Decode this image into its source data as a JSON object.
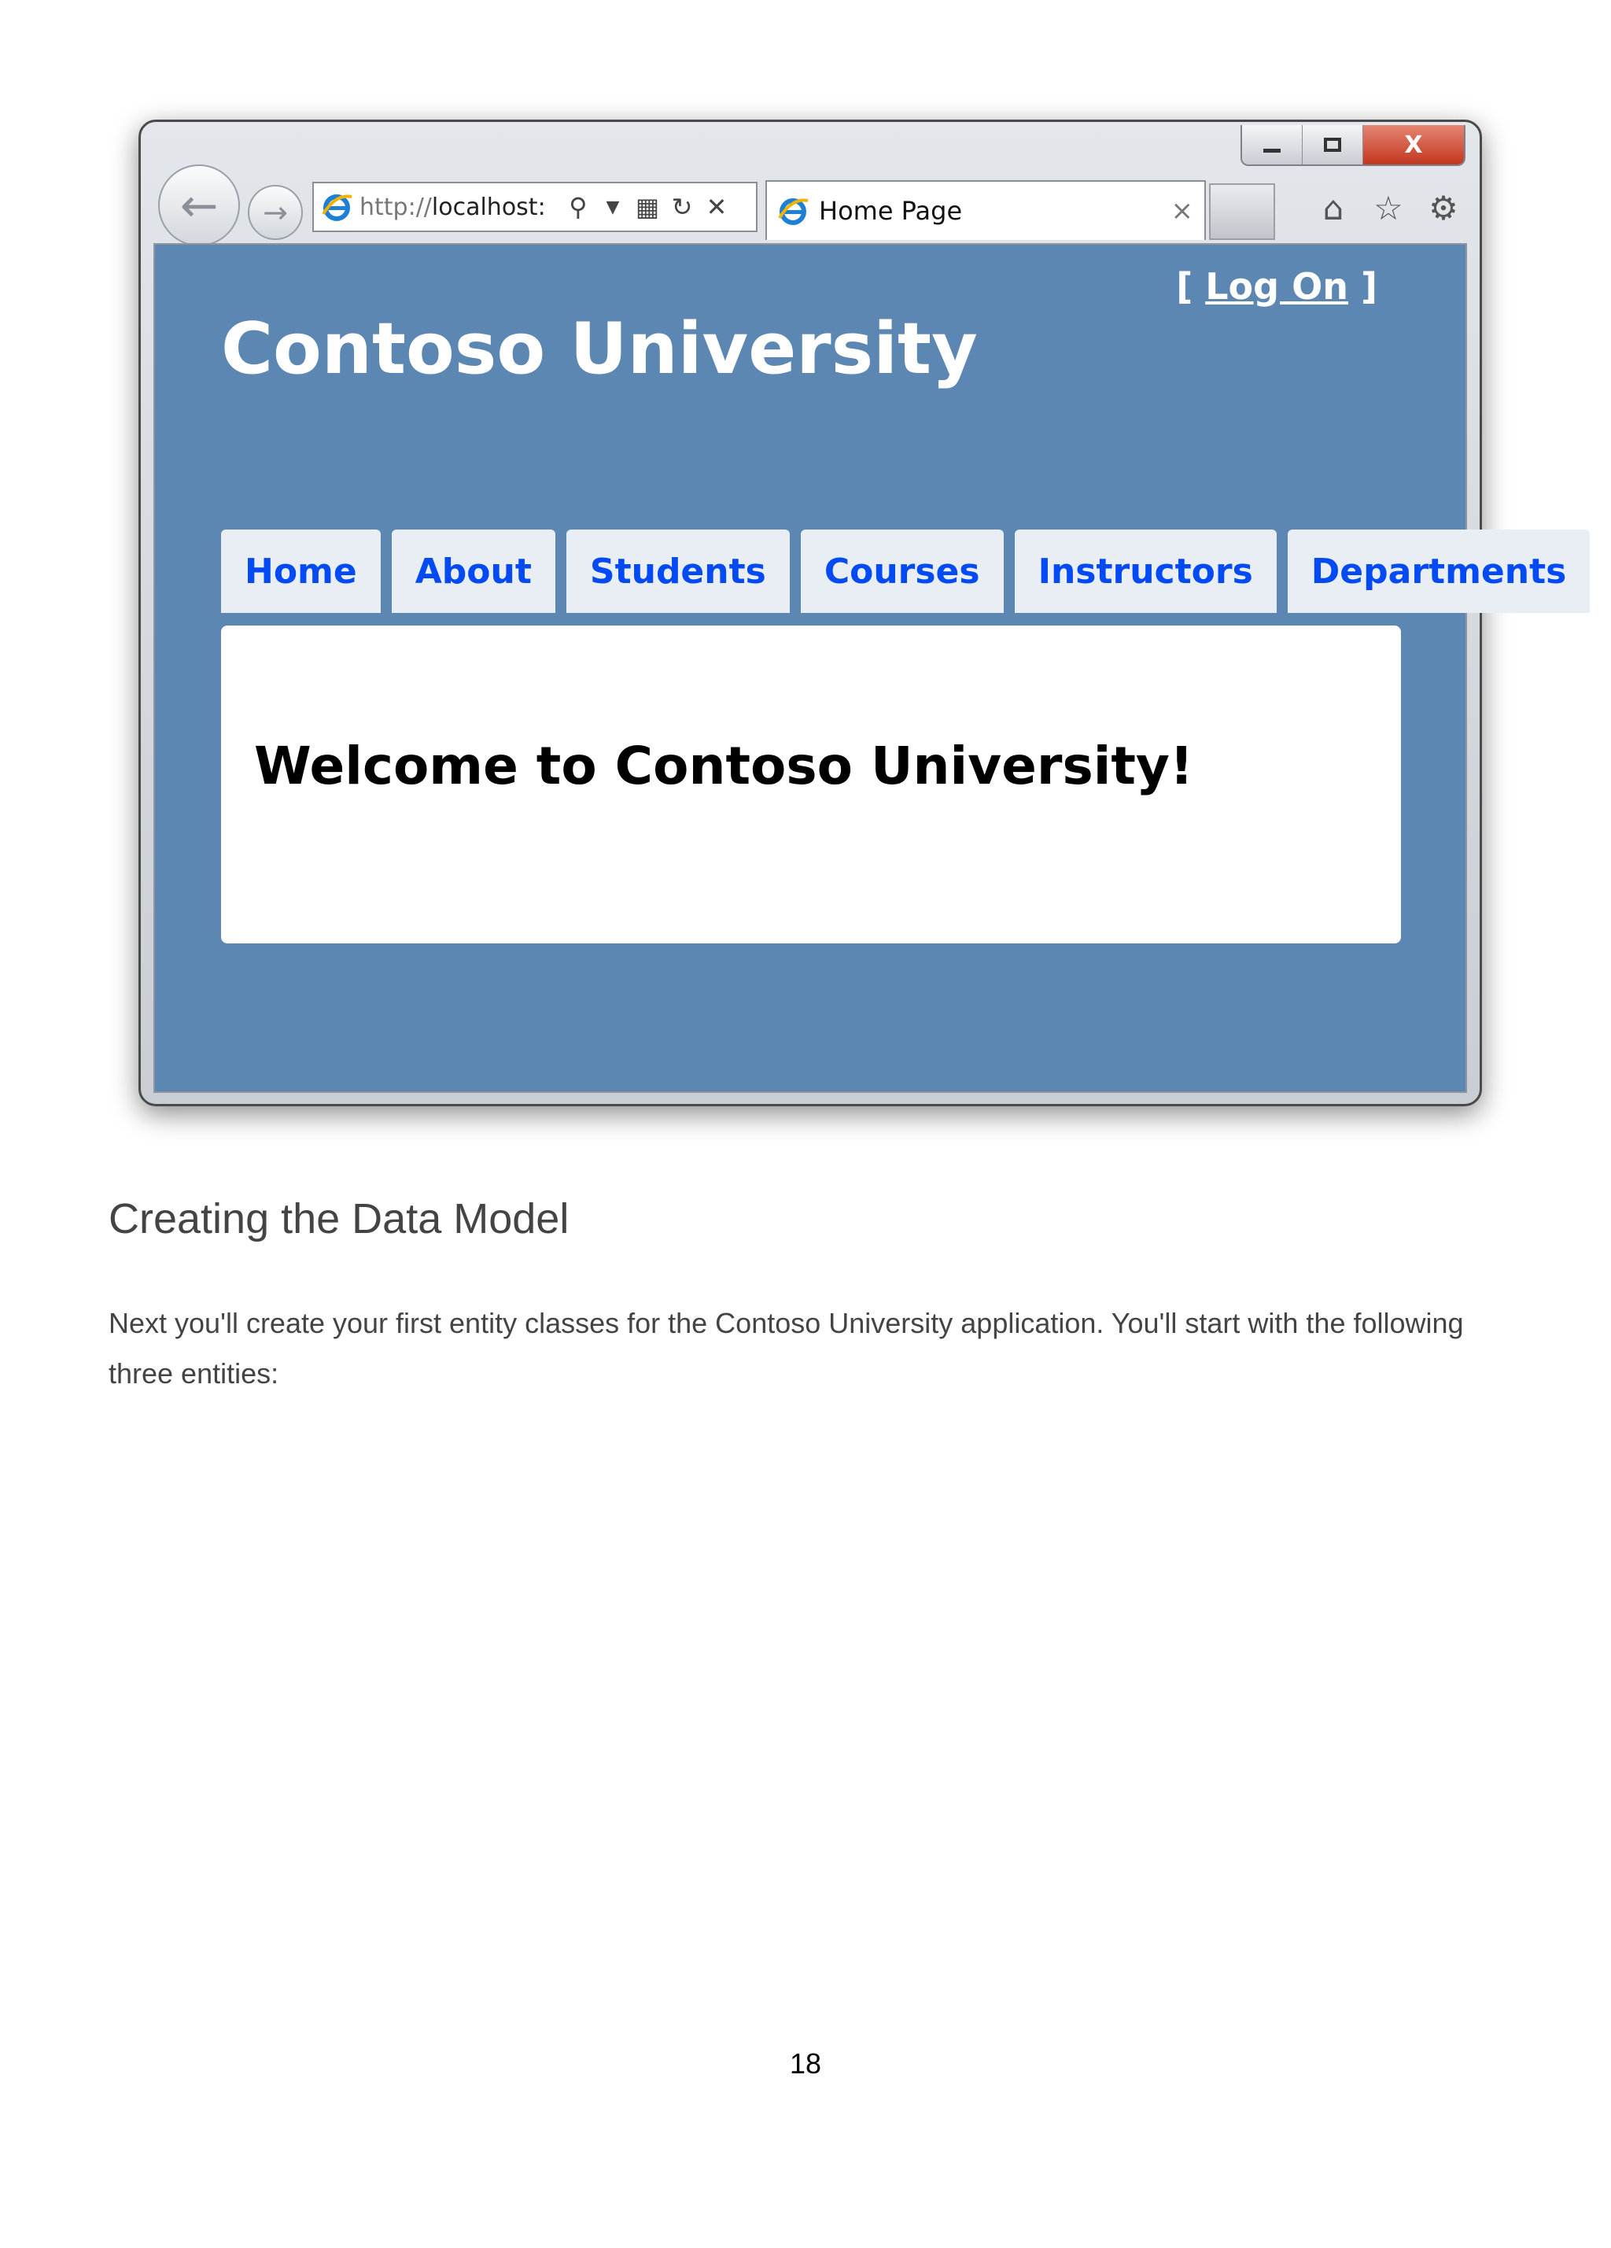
{
  "browser": {
    "window_controls": {
      "minimize": "",
      "maximize": "",
      "close": "X"
    },
    "address": {
      "scheme": "http://",
      "host": "localhost:"
    },
    "tab": {
      "title": "Home Page",
      "close": "×"
    }
  },
  "site": {
    "logon": {
      "open": "[ ",
      "link": "Log On",
      "close": " ]"
    },
    "title": "Contoso University",
    "menu": [
      "Home",
      "About",
      "Students",
      "Courses",
      "Instructors",
      "Departments"
    ],
    "welcome": "Welcome to Contoso University!",
    "colors": {
      "header_bg": "#5c87b2",
      "menu_bg": "#e8eef4",
      "menu_text": "#034af3"
    }
  },
  "document": {
    "heading": "Creating the Data Model",
    "paragraph": "Next you'll create your first entity classes for the Contoso University application. You'll start with the following three entities:",
    "page_number": "18"
  }
}
